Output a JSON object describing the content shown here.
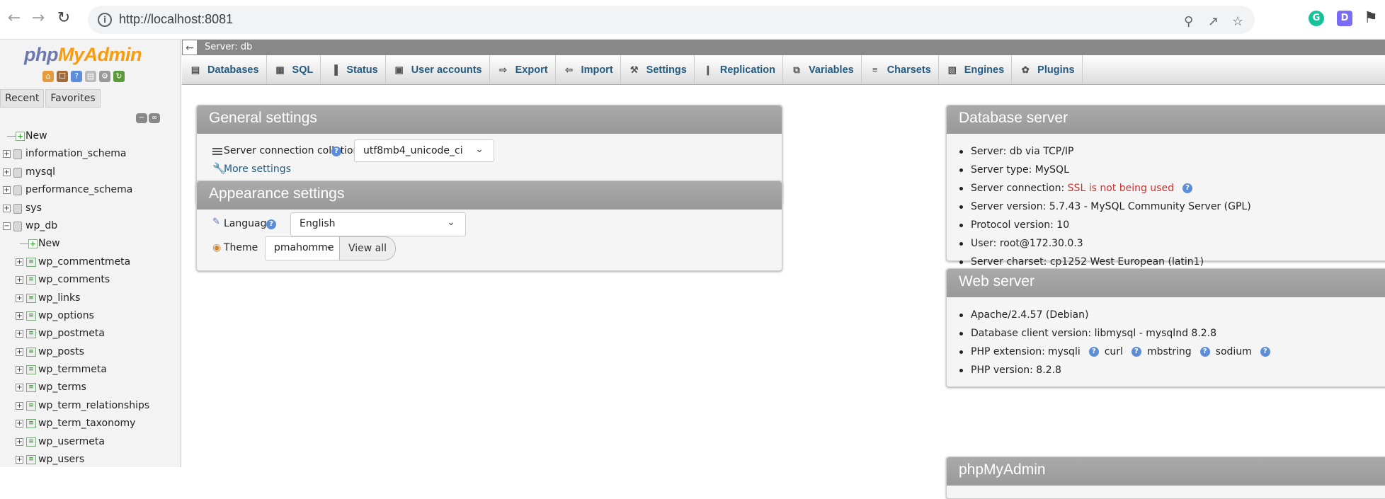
{
  "browser": {
    "url": "http://localhost:8081",
    "ext_g": "G",
    "ext_d": "D"
  },
  "sidebar": {
    "logo_php": "php",
    "logo_myadmin": "MyAdmin",
    "tab_recent": "Recent",
    "tab_favorites": "Favorites",
    "tree": [
      {
        "label": "New",
        "kind": "new",
        "level": 0
      },
      {
        "label": "information_schema",
        "kind": "db",
        "level": 0
      },
      {
        "label": "mysql",
        "kind": "db",
        "level": 0
      },
      {
        "label": "performance_schema",
        "kind": "db",
        "level": 0
      },
      {
        "label": "sys",
        "kind": "db",
        "level": 0
      },
      {
        "label": "wp_db",
        "kind": "db-open",
        "level": 0
      },
      {
        "label": "New",
        "kind": "new",
        "level": 1
      },
      {
        "label": "wp_commentmeta",
        "kind": "table",
        "level": 1
      },
      {
        "label": "wp_comments",
        "kind": "table",
        "level": 1
      },
      {
        "label": "wp_links",
        "kind": "table",
        "level": 1
      },
      {
        "label": "wp_options",
        "kind": "table",
        "level": 1
      },
      {
        "label": "wp_postmeta",
        "kind": "table",
        "level": 1
      },
      {
        "label": "wp_posts",
        "kind": "table",
        "level": 1
      },
      {
        "label": "wp_termmeta",
        "kind": "table",
        "level": 1
      },
      {
        "label": "wp_terms",
        "kind": "table",
        "level": 1
      },
      {
        "label": "wp_term_relationships",
        "kind": "table",
        "level": 1
      },
      {
        "label": "wp_term_taxonomy",
        "kind": "table",
        "level": 1
      },
      {
        "label": "wp_usermeta",
        "kind": "table",
        "level": 1
      },
      {
        "label": "wp_users",
        "kind": "table",
        "level": 1
      }
    ]
  },
  "breadcrumb": {
    "server": "Server: db"
  },
  "topmenu": {
    "tabs": [
      {
        "label": "Databases",
        "icon": "database-icon"
      },
      {
        "label": "SQL",
        "icon": "sql-icon"
      },
      {
        "label": "Status",
        "icon": "status-icon"
      },
      {
        "label": "User accounts",
        "icon": "users-icon"
      },
      {
        "label": "Export",
        "icon": "export-icon"
      },
      {
        "label": "Import",
        "icon": "import-icon"
      },
      {
        "label": "Settings",
        "icon": "wrench-icon"
      },
      {
        "label": "Replication",
        "icon": "replication-icon"
      },
      {
        "label": "Variables",
        "icon": "variables-icon"
      },
      {
        "label": "Charsets",
        "icon": "charsets-icon"
      },
      {
        "label": "Engines",
        "icon": "engines-icon"
      },
      {
        "label": "Plugins",
        "icon": "plugins-icon"
      }
    ]
  },
  "general": {
    "title": "General settings",
    "collation_label": "Server connection collation:",
    "collation_value": "utf8mb4_unicode_ci",
    "more_settings": "More settings"
  },
  "appearance": {
    "title": "Appearance settings",
    "language_label": "Language",
    "language_value": "English",
    "theme_label": "Theme",
    "theme_value": "pmahomme",
    "view_all": "View all"
  },
  "db_server": {
    "title": "Database server",
    "items": [
      {
        "pre": "Server: db via TCP/IP"
      },
      {
        "pre": "Server type: MySQL"
      },
      {
        "pre": "Server connection: ",
        "red": "SSL is not being used",
        "help": true
      },
      {
        "pre": "Server version: 5.7.43 - MySQL Community Server (GPL)"
      },
      {
        "pre": "Protocol version: 10"
      },
      {
        "pre": "User: root@172.30.0.3"
      },
      {
        "pre": "Server charset: cp1252 West European (latin1)"
      }
    ]
  },
  "web_server": {
    "title": "Web server",
    "items": [
      "Apache/2.4.57 (Debian)",
      "Database client version: libmysql - mysqlnd 8.2.8"
    ],
    "php_ext_label": "PHP extension:",
    "php_ext": [
      "mysqli",
      "curl",
      "mbstring",
      "sodium"
    ],
    "php_version": "PHP version: 8.2.8"
  },
  "pma_panel": {
    "title": "phpMyAdmin"
  },
  "colors": {
    "link": "#235a81",
    "panel_header": "#999999",
    "warn": "#cc3333",
    "logo_blue": "#6c78af",
    "logo_orange": "#f89c0e"
  }
}
